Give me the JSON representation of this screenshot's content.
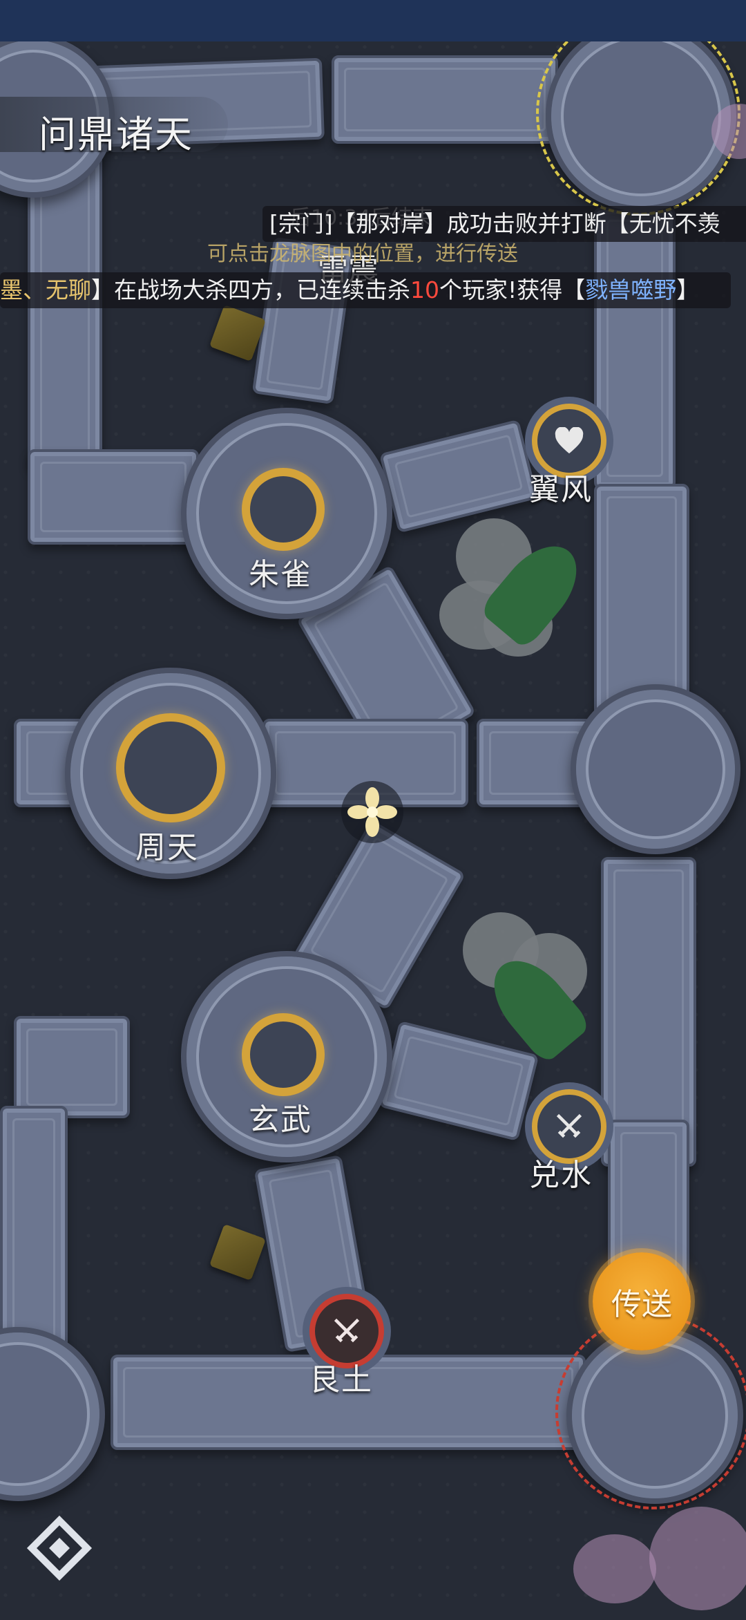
{
  "map": {
    "title": "问鼎诸天",
    "hint": "可点击龙脉图中的位置，进行传送",
    "partial_label": "雷震",
    "partial_timer": "后10:34后结束"
  },
  "messages": [
    {
      "parts": [
        "[宗门]【那对岸】成功击败并打断【无忧不羡"
      ]
    },
    {
      "prefix": "墨、",
      "name": "无聊",
      "mid": "】在战场大杀四方，已连续击杀",
      "count": "10",
      "mid2": "个玩家!获得【",
      "reward": "戮兽噬野",
      "suffix": "】"
    }
  ],
  "nodes": {
    "zhuque": "朱雀",
    "zhoutian": "周天",
    "xuanwu": "玄武",
    "yifeng": "翼风",
    "duishui": "兑水",
    "gentu": "艮土"
  },
  "teleport_button": "传送",
  "colors": {
    "gold": "#d4a33a",
    "red": "#c63d32",
    "orange": "#e58c12",
    "status": "#1f3358"
  },
  "icons": {
    "heart": "heart-icon",
    "swords": "crossed-swords-icon",
    "player": "flower-player-icon",
    "compass": "compass-icon"
  }
}
